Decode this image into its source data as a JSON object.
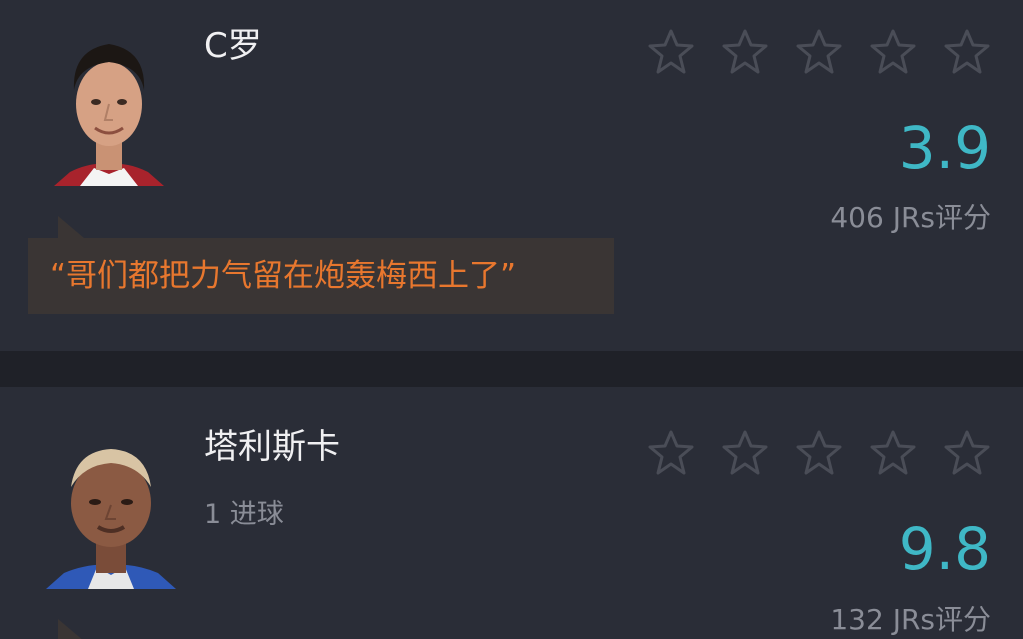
{
  "colors": {
    "background": "#2a2d37",
    "separator": "#1f2128",
    "score": "#3fb8c6",
    "quote_text": "#e8772e",
    "quote_bg": "#3a3534",
    "star_outline": "#4a4d57"
  },
  "players": [
    {
      "name": "C罗",
      "stat": "",
      "stars_total": 5,
      "stars_selected": 0,
      "score": "3.9",
      "rating_count": "406 JRs评分",
      "quote": "“哥们都把力气留在炮轰梅西上了”"
    },
    {
      "name": "塔利斯卡",
      "stat": "1 进球",
      "stars_total": 5,
      "stars_selected": 0,
      "score": "9.8",
      "rating_count": "132 JRs评分"
    }
  ]
}
